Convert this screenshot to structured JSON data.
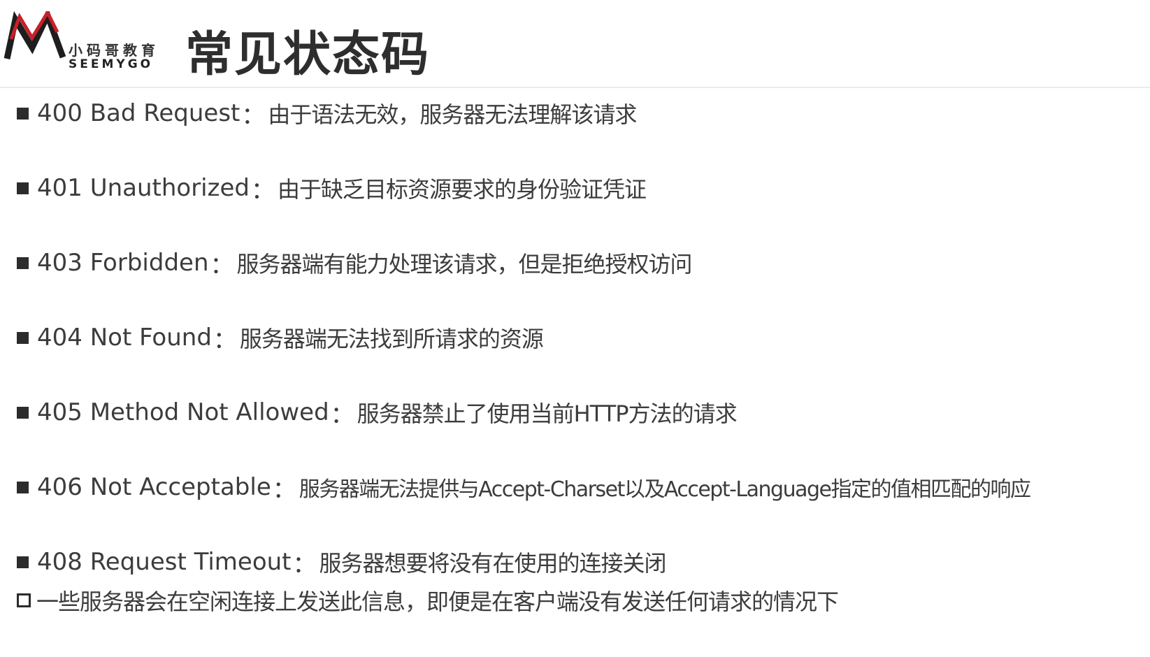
{
  "logo": {
    "cn": "小码哥教育",
    "en": "SEEMYGO",
    "icon": "seemygo-m-logo"
  },
  "title": "常见状态码",
  "colon": "：",
  "items": [
    {
      "code": "400 Bad Request",
      "desc": "由于语法无效，服务器无法理解该请求"
    },
    {
      "code": "401 Unauthorized",
      "desc": "由于缺乏目标资源要求的身份验证凭证"
    },
    {
      "code": "403 Forbidden",
      "desc": "服务器端有能力处理该请求，但是拒绝授权访问"
    },
    {
      "code": "404 Not Found",
      "desc": "服务器端无法找到所请求的资源"
    },
    {
      "code": "405 Method Not Allowed",
      "desc": "服务器禁止了使用当前HTTP方法的请求"
    },
    {
      "code": "406 Not Acceptable",
      "desc": "服务器端无法提供与Accept-Charset以及Accept-Language指定的值相匹配的响应"
    },
    {
      "code": "408 Request Timeout",
      "desc": "服务器想要将没有在使用的连接关闭"
    }
  ],
  "sub_item": {
    "desc": "一些服务器会在空闲连接上发送此信息，即便是在客户端没有发送任何请求的情况下"
  },
  "colors": {
    "logo_red": "#c8202a",
    "logo_dark": "#1e1e1e",
    "text": "#3c3c3c",
    "bullet": "#2c2c2c"
  }
}
